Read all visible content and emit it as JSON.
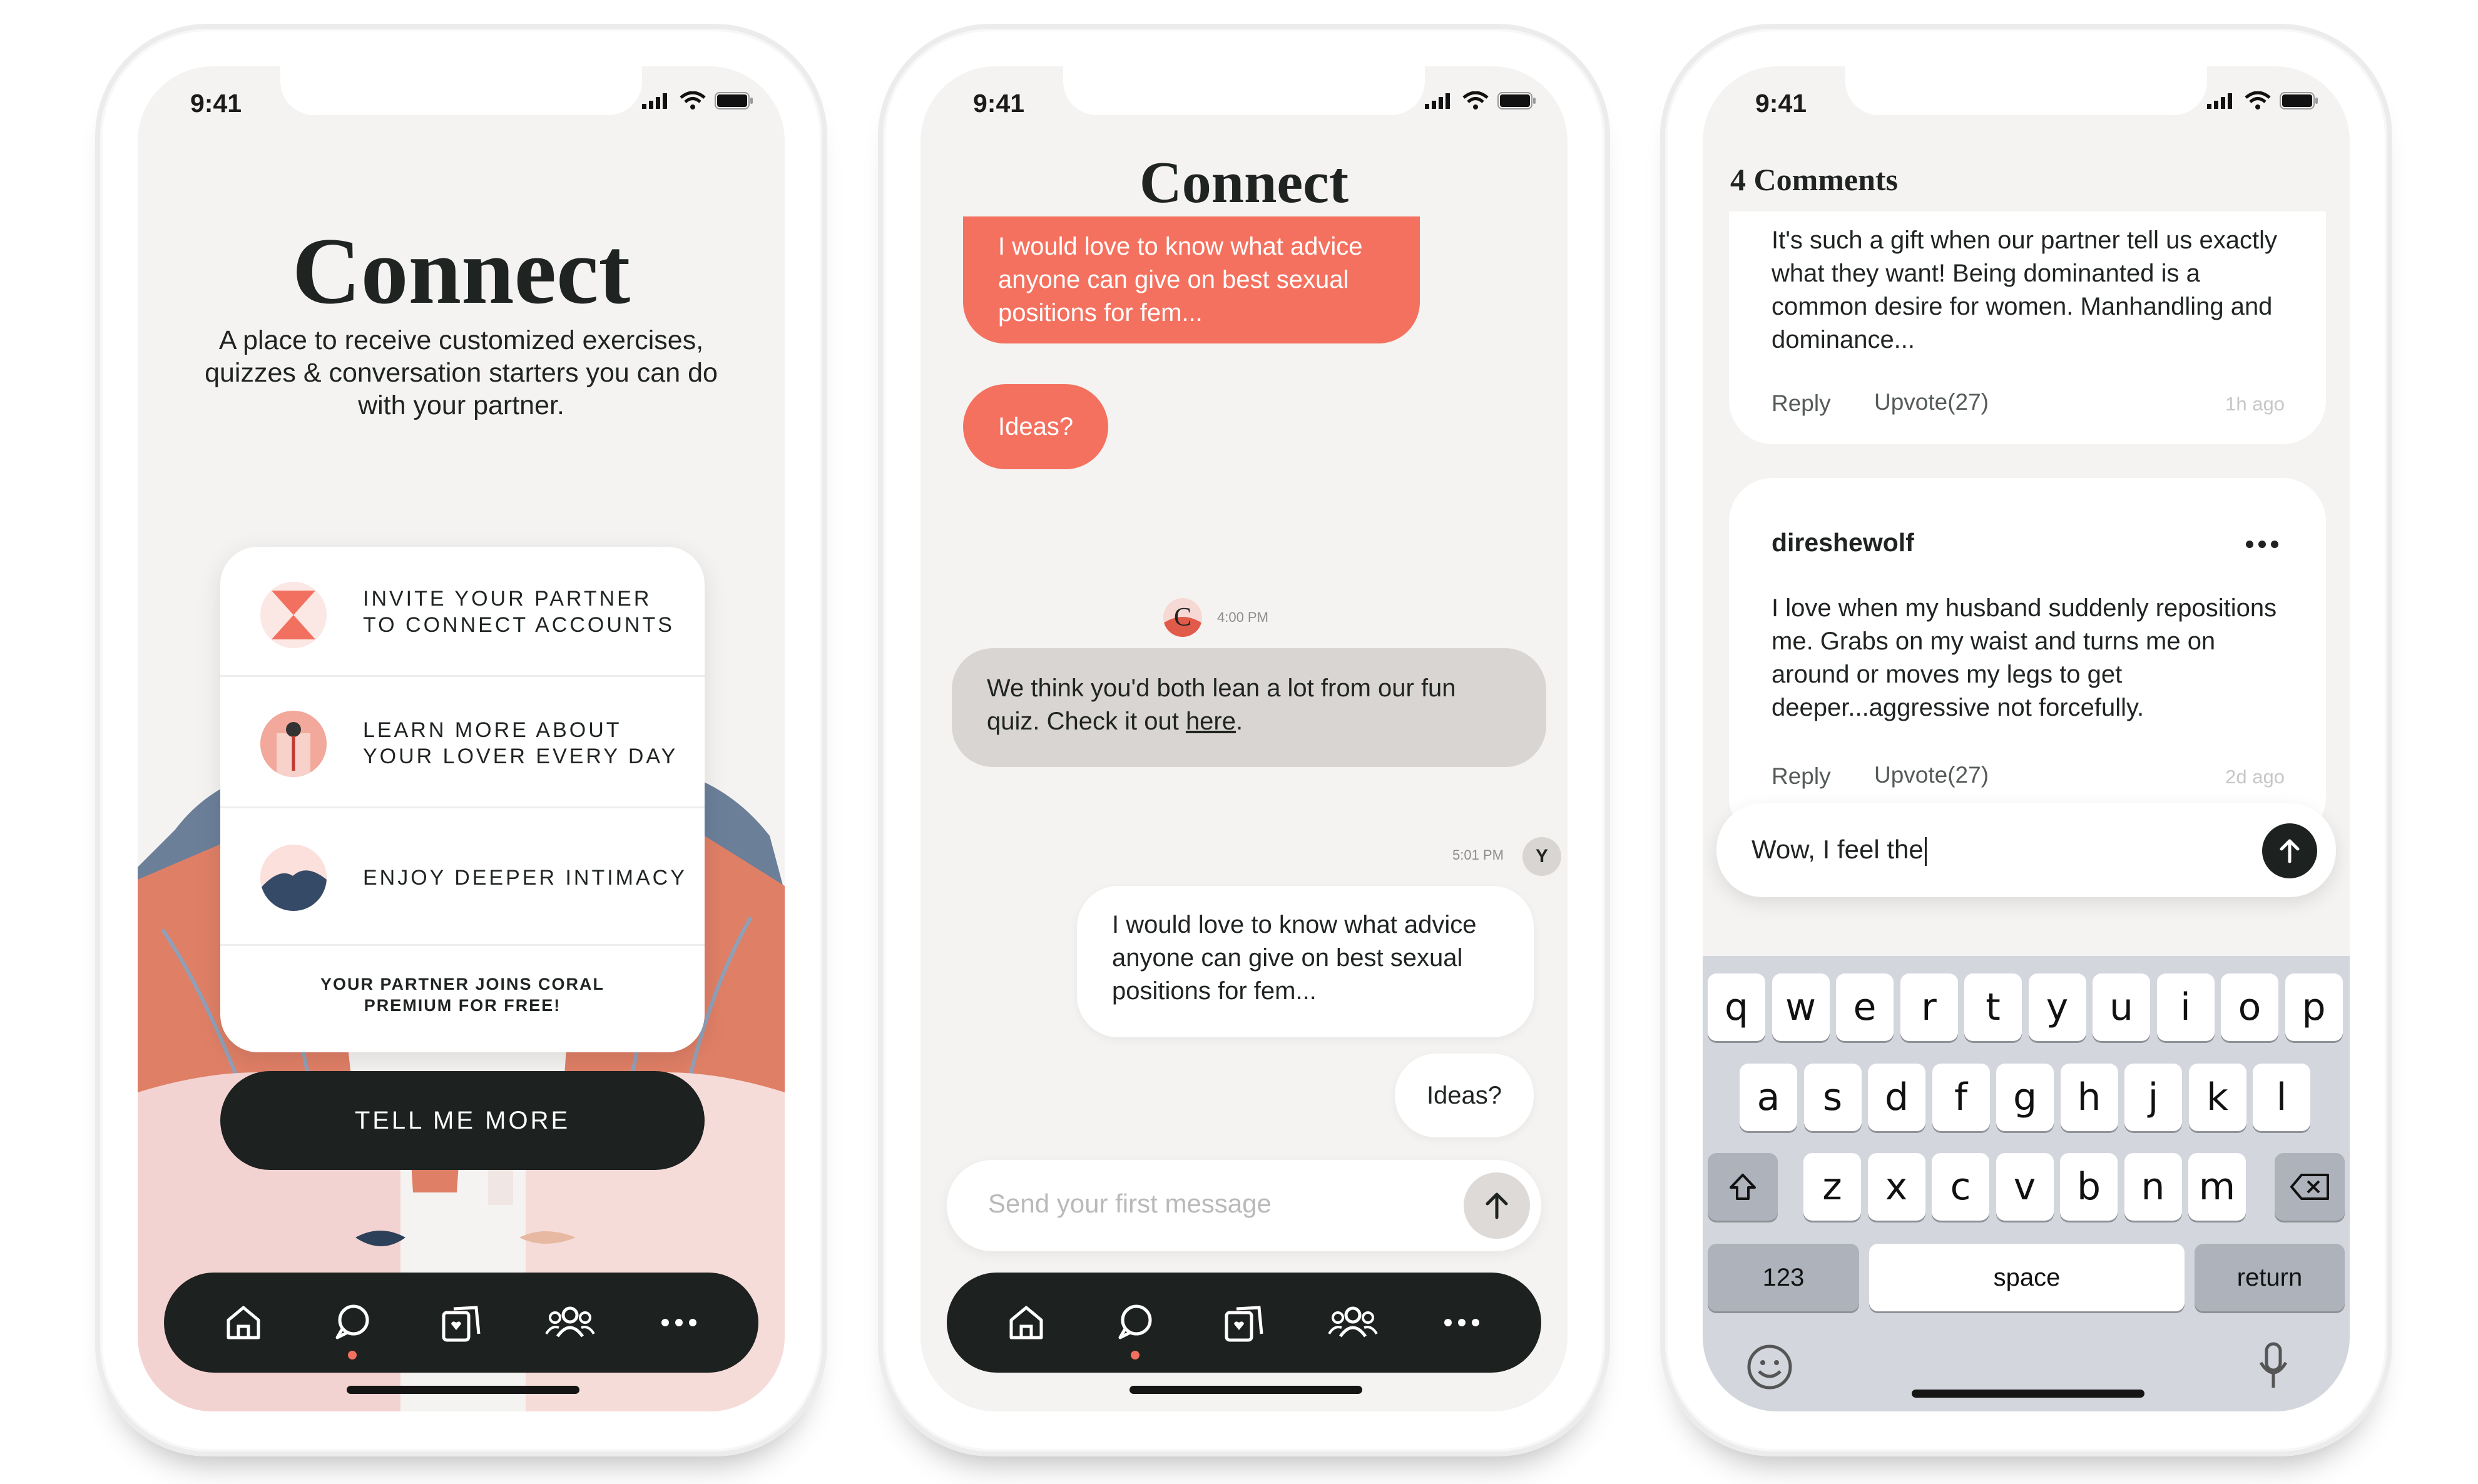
{
  "status_time": "9:41",
  "phone1": {
    "title": "Connect",
    "subtitle": "A place to receive customized exercises, quizzes & conversation starters you can do with your partner.",
    "card_items": [
      {
        "line1": "INVITE YOUR PARTNER",
        "line2": "TO CONNECT ACCOUNTS",
        "icon": "hourglass-icon"
      },
      {
        "line1": "LEARN MORE ABOUT",
        "line2": "YOUR LOVER EVERY DAY",
        "icon": "figure-icon"
      },
      {
        "line1": "ENJOY DEEPER INTIMACY",
        "line2": "",
        "icon": "mountain-icon"
      }
    ],
    "card_footer_line1": "YOUR PARTNER JOINS CORAL",
    "card_footer_line2": "PREMIUM FOR FREE!",
    "cta": "TELL ME MORE"
  },
  "phone2": {
    "title": "Connect",
    "user_message": "I would love to know what advice anyone can give on best sexual positions for fem...",
    "user_followup": "Ideas?",
    "bot_time": "4:00 PM",
    "bot_message_prefix": "We think you'd both lean a lot from our fun quiz. Check it out ",
    "bot_message_link": "here",
    "bot_message_suffix": ".",
    "reply_time": "5:01 PM",
    "reply_avatar": "Y",
    "reply_message": "I would love to know what advice anyone can give on best sexual positions for fem...",
    "reply_followup": "Ideas?",
    "input_placeholder": "Send your first message"
  },
  "phone3": {
    "comments_count": "4",
    "comments_label": "Comments",
    "comments": [
      {
        "author": "",
        "text": "It's such a gift when our partner tell us exactly what they want! Being dominanted is a common desire for women. Manhandling and dominance...",
        "reply": "Reply",
        "upvote": "Upvote(27)",
        "ago": "1h ago"
      },
      {
        "author": "direshewolf",
        "text": "I love when my husband suddenly repositions me. Grabs on my waist and turns me on around or moves my legs to get deeper...aggressive not forcefully.",
        "reply": "Reply",
        "upvote": "Upvote(27)",
        "ago": "2d ago"
      }
    ],
    "input_value": "Wow, I feel the",
    "keyboard_row1": [
      "q",
      "w",
      "e",
      "r",
      "t",
      "y",
      "u",
      "i",
      "o",
      "p"
    ],
    "keyboard_row2": [
      "a",
      "s",
      "d",
      "f",
      "g",
      "h",
      "j",
      "k",
      "l"
    ],
    "keyboard_row3": [
      "z",
      "x",
      "c",
      "v",
      "b",
      "n",
      "m"
    ],
    "key_numbers": "123",
    "key_space": "space",
    "key_return": "return"
  },
  "nav_items": [
    "home-icon",
    "chat-icon",
    "cards-icon",
    "community-icon",
    "more-icon"
  ],
  "colors": {
    "coral": "#f5715f",
    "dark": "#1d2120",
    "screen_bg": "#f4f3f1",
    "keyboard_bg": "#d3d6dd"
  }
}
